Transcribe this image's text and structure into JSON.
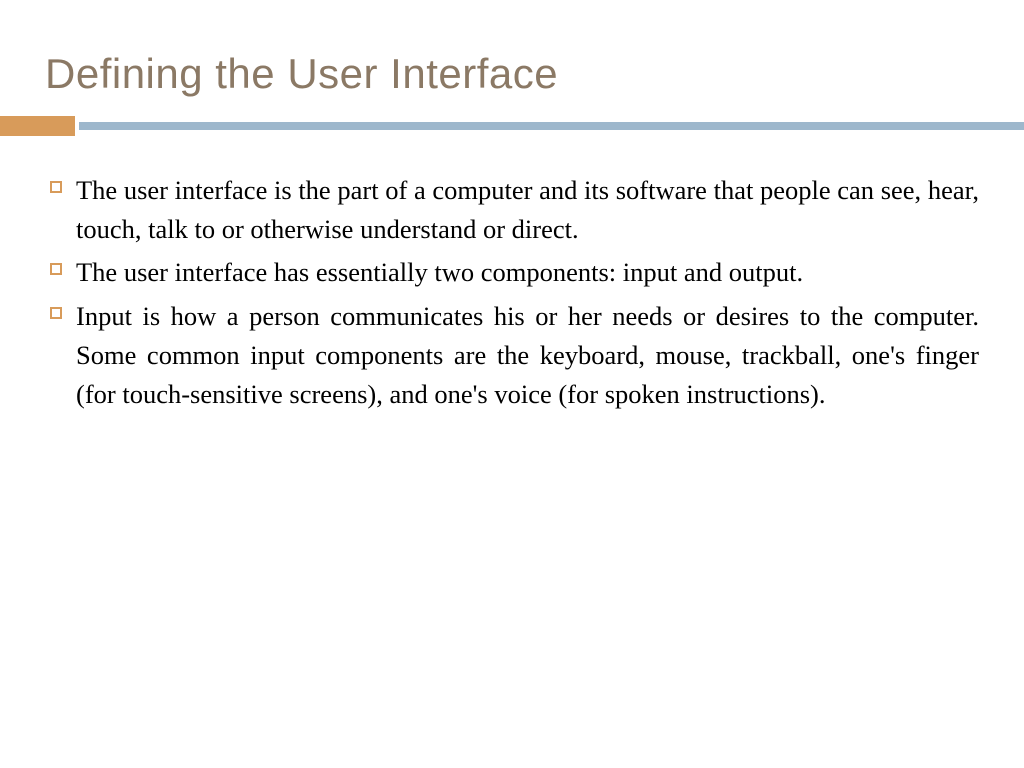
{
  "title": "Defining the User Interface",
  "bullets": [
    "The user interface is the part of a computer and its software that people can see, hear, touch, talk to or otherwise understand or direct.",
    "The user interface has essentially two components: input and output.",
    "Input is how a person communicates his or her needs or desires to the computer. Some common input components are the keyboard, mouse, trackball, one's finger (for touch-sensitive screens), and one's voice (for spoken instructions)."
  ],
  "colors": {
    "title": "#8b7965",
    "accent": "#d89b5a",
    "divider": "#9db7cc"
  }
}
